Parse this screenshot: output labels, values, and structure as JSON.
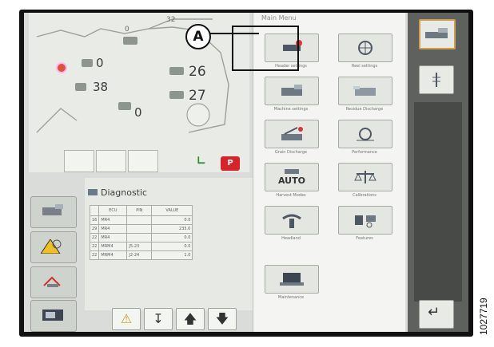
{
  "status_panel": {
    "grain_level": "0",
    "bales_value": "0",
    "temperature_value": "38",
    "loss_value": "0",
    "speed_value": "26",
    "rotor_value": "27",
    "header_speed": "32",
    "park_label": "P"
  },
  "diagnostic": {
    "title": "Diagnostic",
    "headers": [
      "",
      "ECU",
      "PIN",
      "VALUE"
    ],
    "rows": [
      [
        "16",
        "MR4",
        "",
        "0.0"
      ],
      [
        "29",
        "MR4",
        "",
        "235.0"
      ],
      [
        "22",
        "MR4",
        "",
        "0.0"
      ],
      [
        "22",
        "MRM4",
        "J5-23",
        "0.0"
      ],
      [
        "22",
        "MRM4",
        "J2-24",
        "1.0"
      ]
    ]
  },
  "main_menu": {
    "title": "Main Menu",
    "tiles": [
      {
        "label": "Header settings",
        "icon": "header-icon"
      },
      {
        "label": "Reel settings",
        "icon": "reel-icon"
      },
      {
        "label": "Machine settings",
        "icon": "combine-icon"
      },
      {
        "label": "Residue Discharge",
        "icon": "residue-icon"
      },
      {
        "label": "Grain Discharge",
        "icon": "grain-discharge-icon"
      },
      {
        "label": "Performance",
        "icon": "performance-icon"
      },
      {
        "label": "Harvest Modes",
        "icon": "auto-icon"
      },
      {
        "label": "Calibrations",
        "icon": "scale-icon"
      },
      {
        "label": "Headland",
        "icon": "headland-icon"
      },
      {
        "label": "Features",
        "icon": "features-icon"
      },
      {
        "label": "Maintenance",
        "icon": "laptop-icon"
      }
    ],
    "auto_text": "AUTO"
  },
  "callout": {
    "letter": "A"
  },
  "figure_number": "1027719",
  "colors": {
    "rail": "#5e615e",
    "highlight": "#cf9f4f",
    "park": "#d8232a"
  }
}
